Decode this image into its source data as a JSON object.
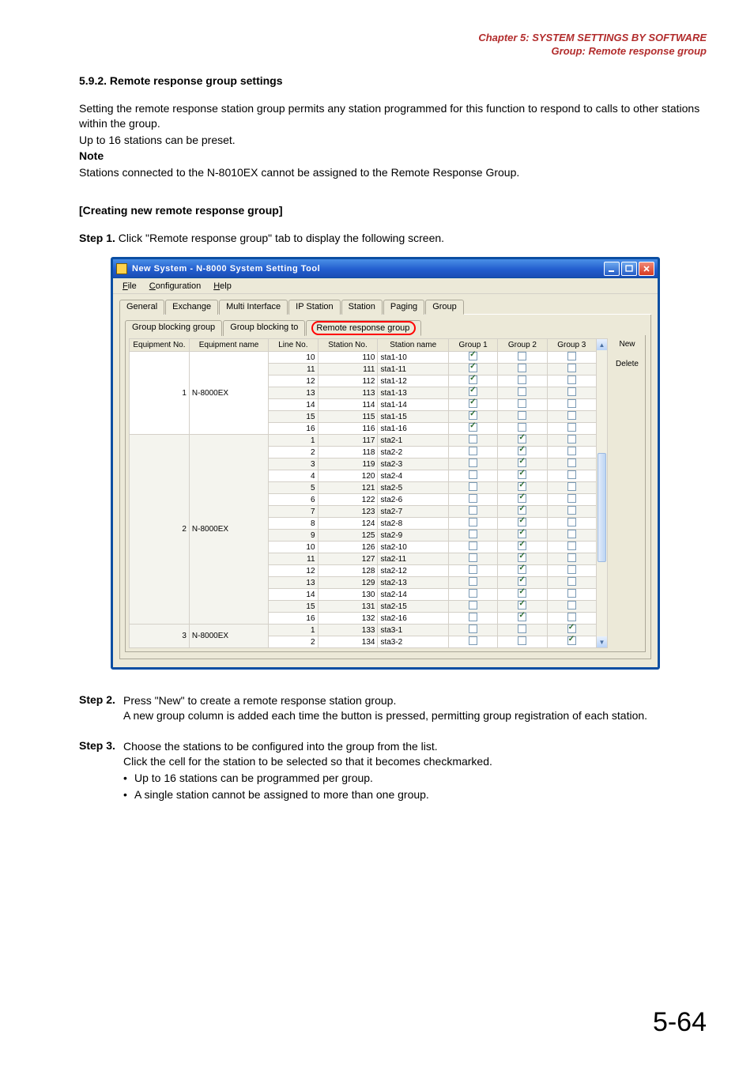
{
  "chapter_header": {
    "line1": "Chapter 5:  SYSTEM SETTINGS BY SOFTWARE",
    "line2": "Group: Remote response group"
  },
  "section_title": "5.9.2. Remote response group settings",
  "intro1": "Setting the remote response station group permits any station programmed for this function to respond to calls to other stations within the group.",
  "intro2": "Up to 16 stations can be preset.",
  "note_label": "Note",
  "note_text": "Stations connected to the N-8010EX cannot be assigned to the Remote Response Group.",
  "create_title": "[Creating new remote response group]",
  "step1_label": "Step 1.",
  "step1_text": "Click \"Remote response group\" tab to display the following screen.",
  "window": {
    "title": "New System - N-8000 System Setting Tool",
    "menu": {
      "file": "File",
      "file_ul": "F",
      "file_rest": "ile",
      "config": "Configuration",
      "config_ul": "C",
      "config_rest": "onfiguration",
      "help": "Help",
      "help_ul": "H",
      "help_rest": "elp"
    },
    "tabs_main": {
      "general": "General",
      "exchange": "Exchange",
      "multi": "Multi Interface",
      "ipstation": "IP Station",
      "station": "Station",
      "paging": "Paging",
      "group": "Group"
    },
    "tabs_sub": {
      "gbg": "Group blocking group",
      "gbt": "Group blocking to",
      "rrg": "Remote response group"
    },
    "headers": {
      "equip_no": "Equipment No.",
      "equip_name": "Equipment name",
      "line_no": "Line No.",
      "station_no": "Station No.",
      "station_name": "Station name",
      "g1": "Group 1",
      "g2": "Group 2",
      "g3": "Group 3"
    },
    "btn_new": "New",
    "btn_delete": "Delete",
    "rows_block1": {
      "equip_no": "1",
      "equip_name": "N-8000EX",
      "rows": [
        {
          "ln": "10",
          "sn": "110",
          "nm": "sta1-10",
          "g1": true,
          "g2": false,
          "g3": false
        },
        {
          "ln": "11",
          "sn": "111",
          "nm": "sta1-11",
          "g1": true,
          "g2": false,
          "g3": false
        },
        {
          "ln": "12",
          "sn": "112",
          "nm": "sta1-12",
          "g1": true,
          "g2": false,
          "g3": false
        },
        {
          "ln": "13",
          "sn": "113",
          "nm": "sta1-13",
          "g1": true,
          "g2": false,
          "g3": false
        },
        {
          "ln": "14",
          "sn": "114",
          "nm": "sta1-14",
          "g1": true,
          "g2": false,
          "g3": false
        },
        {
          "ln": "15",
          "sn": "115",
          "nm": "sta1-15",
          "g1": true,
          "g2": false,
          "g3": false
        },
        {
          "ln": "16",
          "sn": "116",
          "nm": "sta1-16",
          "g1": true,
          "g2": false,
          "g3": false
        }
      ]
    },
    "rows_block2": {
      "equip_no": "2",
      "equip_name": "N-8000EX",
      "rows": [
        {
          "ln": "1",
          "sn": "117",
          "nm": "sta2-1",
          "g1": false,
          "g2": true,
          "g3": false
        },
        {
          "ln": "2",
          "sn": "118",
          "nm": "sta2-2",
          "g1": false,
          "g2": true,
          "g3": false
        },
        {
          "ln": "3",
          "sn": "119",
          "nm": "sta2-3",
          "g1": false,
          "g2": true,
          "g3": false
        },
        {
          "ln": "4",
          "sn": "120",
          "nm": "sta2-4",
          "g1": false,
          "g2": true,
          "g3": false
        },
        {
          "ln": "5",
          "sn": "121",
          "nm": "sta2-5",
          "g1": false,
          "g2": true,
          "g3": false
        },
        {
          "ln": "6",
          "sn": "122",
          "nm": "sta2-6",
          "g1": false,
          "g2": true,
          "g3": false
        },
        {
          "ln": "7",
          "sn": "123",
          "nm": "sta2-7",
          "g1": false,
          "g2": true,
          "g3": false
        },
        {
          "ln": "8",
          "sn": "124",
          "nm": "sta2-8",
          "g1": false,
          "g2": true,
          "g3": false
        },
        {
          "ln": "9",
          "sn": "125",
          "nm": "sta2-9",
          "g1": false,
          "g2": true,
          "g3": false
        },
        {
          "ln": "10",
          "sn": "126",
          "nm": "sta2-10",
          "g1": false,
          "g2": true,
          "g3": false
        },
        {
          "ln": "11",
          "sn": "127",
          "nm": "sta2-11",
          "g1": false,
          "g2": true,
          "g3": false
        },
        {
          "ln": "12",
          "sn": "128",
          "nm": "sta2-12",
          "g1": false,
          "g2": true,
          "g3": false
        },
        {
          "ln": "13",
          "sn": "129",
          "nm": "sta2-13",
          "g1": false,
          "g2": true,
          "g3": false
        },
        {
          "ln": "14",
          "sn": "130",
          "nm": "sta2-14",
          "g1": false,
          "g2": true,
          "g3": false
        },
        {
          "ln": "15",
          "sn": "131",
          "nm": "sta2-15",
          "g1": false,
          "g2": true,
          "g3": false
        },
        {
          "ln": "16",
          "sn": "132",
          "nm": "sta2-16",
          "g1": false,
          "g2": true,
          "g3": false
        }
      ]
    },
    "rows_block3": {
      "equip_no": "3",
      "equip_name": "N-8000EX",
      "rows": [
        {
          "ln": "1",
          "sn": "133",
          "nm": "sta3-1",
          "g1": false,
          "g2": false,
          "g3": true
        },
        {
          "ln": "2",
          "sn": "134",
          "nm": "sta3-2",
          "g1": false,
          "g2": false,
          "g3": true
        }
      ]
    }
  },
  "step2_label": "Step 2.",
  "step2_line1": "Press \"New\" to create a remote response station group.",
  "step2_line2": "A new group column is added each time the button is pressed, permitting group registration of each station.",
  "step3_label": "Step 3.",
  "step3_line1": "Choose the stations to be configured into the group from the list.",
  "step3_line2": "Click the cell for the station to be selected so that it becomes checkmarked.",
  "step3_b1": "Up to 16 stations can be programmed per group.",
  "step3_b2": "A single station cannot be assigned to more than one group.",
  "bullet": "•",
  "page_number": "5-64"
}
